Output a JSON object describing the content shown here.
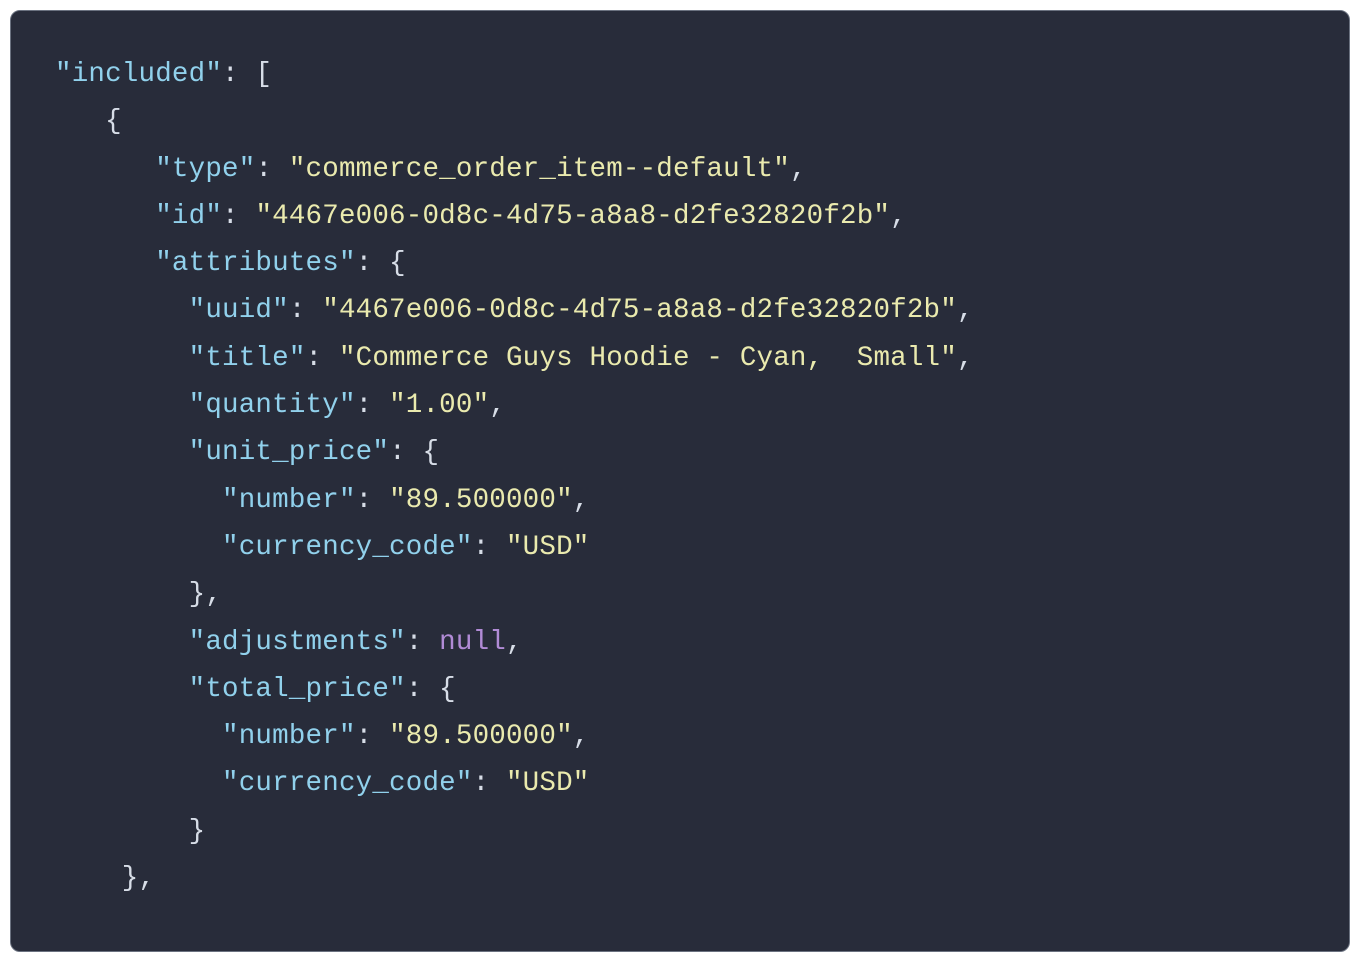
{
  "code": {
    "tokens": [
      [
        {
          "t": "key",
          "v": "\"included\""
        },
        {
          "t": "colon",
          "v": ": "
        },
        {
          "t": "punc",
          "v": "["
        }
      ],
      [
        {
          "t": "punc",
          "v": "   {"
        }
      ],
      [
        {
          "t": "punc",
          "v": "      "
        },
        {
          "t": "key",
          "v": "\"type\""
        },
        {
          "t": "colon",
          "v": ": "
        },
        {
          "t": "str",
          "v": "\"commerce_order_item--default\""
        },
        {
          "t": "punc",
          "v": ","
        }
      ],
      [
        {
          "t": "punc",
          "v": "      "
        },
        {
          "t": "key",
          "v": "\"id\""
        },
        {
          "t": "colon",
          "v": ": "
        },
        {
          "t": "str",
          "v": "\"4467e006-0d8c-4d75-a8a8-d2fe32820f2b\""
        },
        {
          "t": "punc",
          "v": ","
        }
      ],
      [
        {
          "t": "punc",
          "v": "      "
        },
        {
          "t": "key",
          "v": "\"attributes\""
        },
        {
          "t": "colon",
          "v": ": "
        },
        {
          "t": "punc",
          "v": "{"
        }
      ],
      [
        {
          "t": "punc",
          "v": "        "
        },
        {
          "t": "key",
          "v": "\"uuid\""
        },
        {
          "t": "colon",
          "v": ": "
        },
        {
          "t": "str",
          "v": "\"4467e006-0d8c-4d75-a8a8-d2fe32820f2b\""
        },
        {
          "t": "punc",
          "v": ","
        }
      ],
      [
        {
          "t": "punc",
          "v": "        "
        },
        {
          "t": "key",
          "v": "\"title\""
        },
        {
          "t": "colon",
          "v": ": "
        },
        {
          "t": "str",
          "v": "\"Commerce Guys Hoodie - Cyan,  Small\""
        },
        {
          "t": "punc",
          "v": ","
        }
      ],
      [
        {
          "t": "punc",
          "v": "        "
        },
        {
          "t": "key",
          "v": "\"quantity\""
        },
        {
          "t": "colon",
          "v": ": "
        },
        {
          "t": "str",
          "v": "\"1.00\""
        },
        {
          "t": "punc",
          "v": ","
        }
      ],
      [
        {
          "t": "punc",
          "v": "        "
        },
        {
          "t": "key",
          "v": "\"unit_price\""
        },
        {
          "t": "colon",
          "v": ": "
        },
        {
          "t": "punc",
          "v": "{"
        }
      ],
      [
        {
          "t": "punc",
          "v": "          "
        },
        {
          "t": "key",
          "v": "\"number\""
        },
        {
          "t": "colon",
          "v": ": "
        },
        {
          "t": "str",
          "v": "\"89.500000\""
        },
        {
          "t": "punc",
          "v": ","
        }
      ],
      [
        {
          "t": "punc",
          "v": "          "
        },
        {
          "t": "key",
          "v": "\"currency_code\""
        },
        {
          "t": "colon",
          "v": ": "
        },
        {
          "t": "str",
          "v": "\"USD\""
        }
      ],
      [
        {
          "t": "punc",
          "v": "        },"
        }
      ],
      [
        {
          "t": "punc",
          "v": "        "
        },
        {
          "t": "key",
          "v": "\"adjustments\""
        },
        {
          "t": "colon",
          "v": ": "
        },
        {
          "t": "null",
          "v": "null"
        },
        {
          "t": "punc",
          "v": ","
        }
      ],
      [
        {
          "t": "punc",
          "v": "        "
        },
        {
          "t": "key",
          "v": "\"total_price\""
        },
        {
          "t": "colon",
          "v": ": "
        },
        {
          "t": "punc",
          "v": "{"
        }
      ],
      [
        {
          "t": "punc",
          "v": "          "
        },
        {
          "t": "key",
          "v": "\"number\""
        },
        {
          "t": "colon",
          "v": ": "
        },
        {
          "t": "str",
          "v": "\"89.500000\""
        },
        {
          "t": "punc",
          "v": ","
        }
      ],
      [
        {
          "t": "punc",
          "v": "          "
        },
        {
          "t": "key",
          "v": "\"currency_code\""
        },
        {
          "t": "colon",
          "v": ": "
        },
        {
          "t": "str",
          "v": "\"USD\""
        }
      ],
      [
        {
          "t": "punc",
          "v": "        }"
        }
      ],
      [
        {
          "t": "punc",
          "v": "    },"
        }
      ]
    ],
    "json_value": {
      "included": [
        {
          "type": "commerce_order_item--default",
          "id": "4467e006-0d8c-4d75-a8a8-d2fe32820f2b",
          "attributes": {
            "uuid": "4467e006-0d8c-4d75-a8a8-d2fe32820f2b",
            "title": "Commerce Guys Hoodie - Cyan,  Small",
            "quantity": "1.00",
            "unit_price": {
              "number": "89.500000",
              "currency_code": "USD"
            },
            "adjustments": null,
            "total_price": {
              "number": "89.500000",
              "currency_code": "USD"
            }
          }
        }
      ]
    }
  }
}
